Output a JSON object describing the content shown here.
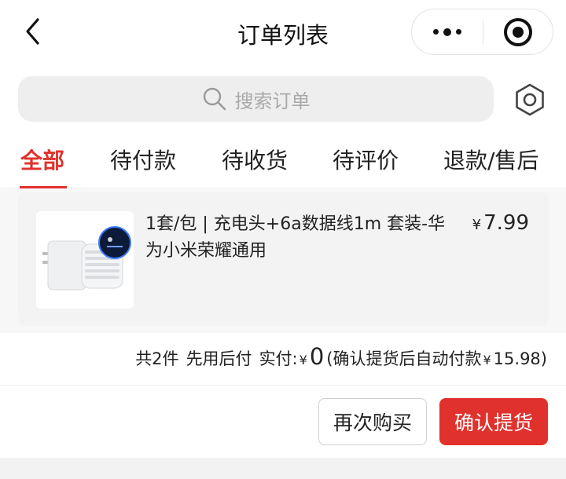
{
  "header": {
    "title": "订单列表",
    "back_icon": "chevron-left-icon",
    "more_icon": "more-dots-icon",
    "close_icon": "target-close-icon"
  },
  "search": {
    "placeholder": "搜索订单",
    "icon": "search-icon"
  },
  "settings_icon": "gear-icon",
  "tabs": [
    {
      "label": "全部",
      "active": true
    },
    {
      "label": "待付款",
      "active": false
    },
    {
      "label": "待收货",
      "active": false
    },
    {
      "label": "待评价",
      "active": false
    },
    {
      "label": "退款/售后",
      "active": false
    }
  ],
  "order": {
    "product_name": "1套/包 | 充电头+6a数据线1m 套装-华为小米荣耀通用",
    "currency": "¥",
    "price": "7.99",
    "thumbnail_icon": "charger-product-image"
  },
  "summary": {
    "count": "共2件",
    "pay_method": "先用后付",
    "paid_label": "实付:",
    "currency": "¥",
    "paid_amount": "0",
    "note_prefix": "(确认提货后自动付款",
    "note_amount": "15.98",
    "note_suffix": ")"
  },
  "actions": {
    "rebuy_label": "再次购买",
    "confirm_label": "确认提货"
  },
  "colors": {
    "accent": "#e0312c",
    "search_bg": "#eeeeee",
    "card_bg": "#f3f3f3"
  }
}
